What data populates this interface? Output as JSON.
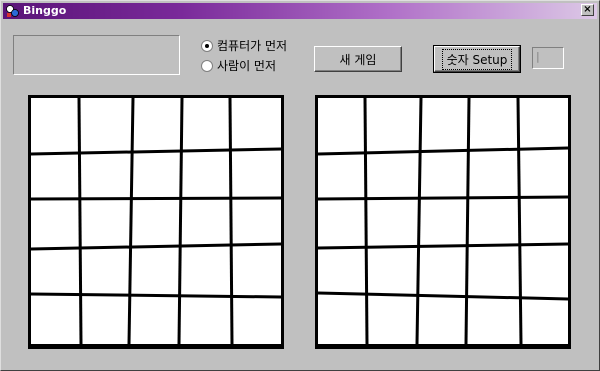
{
  "window": {
    "title": "Binggo",
    "close_label": "×"
  },
  "turn_options": [
    {
      "label": "컴퓨터가 먼저",
      "selected": true
    },
    {
      "label": "사람이 먼저",
      "selected": false
    }
  ],
  "buttons": {
    "new_game": "새 게임",
    "number_setup": "숫자 Setup"
  },
  "number_field": {
    "value": "|"
  },
  "boards": {
    "grid_size": 5,
    "cell_values": []
  },
  "colors": {
    "face": "#c0c0c0",
    "title_start": "#5a1478",
    "title_end": "#dcc8e6",
    "board": "#ffffff",
    "lines": "#000000"
  }
}
